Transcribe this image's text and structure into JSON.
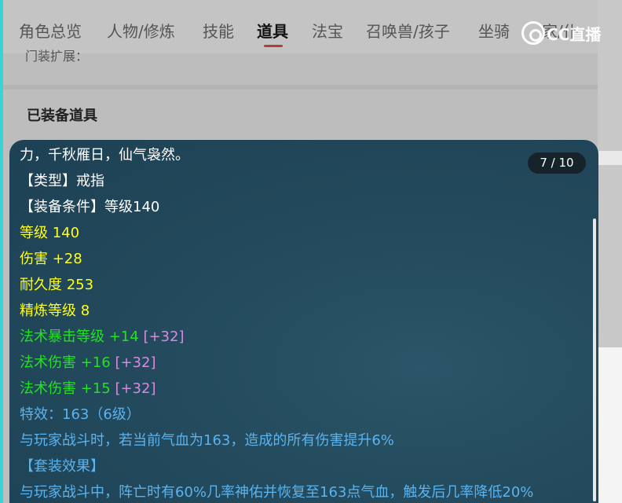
{
  "tabs": [
    {
      "label": "角色总览"
    },
    {
      "label": "人物/修炼"
    },
    {
      "label": "技能"
    },
    {
      "label": "道具"
    },
    {
      "label": "法宝"
    },
    {
      "label": "召唤兽/孩子"
    },
    {
      "label": "坐骑"
    },
    {
      "label": "家/仆"
    }
  ],
  "active_tab": "道具",
  "prev_fragment": "门装扩展：",
  "section_title": "已装备道具",
  "watermark": {
    "text": "CC直播"
  },
  "tooltip": {
    "counter": "7 / 10",
    "top_fragment": "力，千秋雁日，仙气袅然。",
    "type_line": "【类型】戒指",
    "requirement_line": "【装备条件】等级140",
    "level": "等级 140",
    "damage": "伤害 +28",
    "durability": "耐久度 253",
    "refine": "精炼等级 8",
    "stats": [
      {
        "label": "法术暴击等级 +14",
        "bonus": "[+32]"
      },
      {
        "label": "法术伤害 +16",
        "bonus": "[+32]"
      },
      {
        "label": "法术伤害 +15",
        "bonus": "[+32]"
      }
    ],
    "special": "特效：163（6级）",
    "special_desc": "与玩家战斗时，若当前气血为163，造成的所有伤害提升6%",
    "set_title": "【套装效果】",
    "set_desc": "与玩家战斗中，阵亡时有60%几率神佑并恢复至163点气血，触发后几率降低20%"
  },
  "colors": {
    "left_accent": "#36d4d4",
    "active_underline": "#b63b3b",
    "tooltip_bg": "#234a5d",
    "yellow_text": "#ffff1a",
    "green_text": "#24e024",
    "violet_text": "#d68ae0",
    "blue_text": "#5ab4f0"
  }
}
